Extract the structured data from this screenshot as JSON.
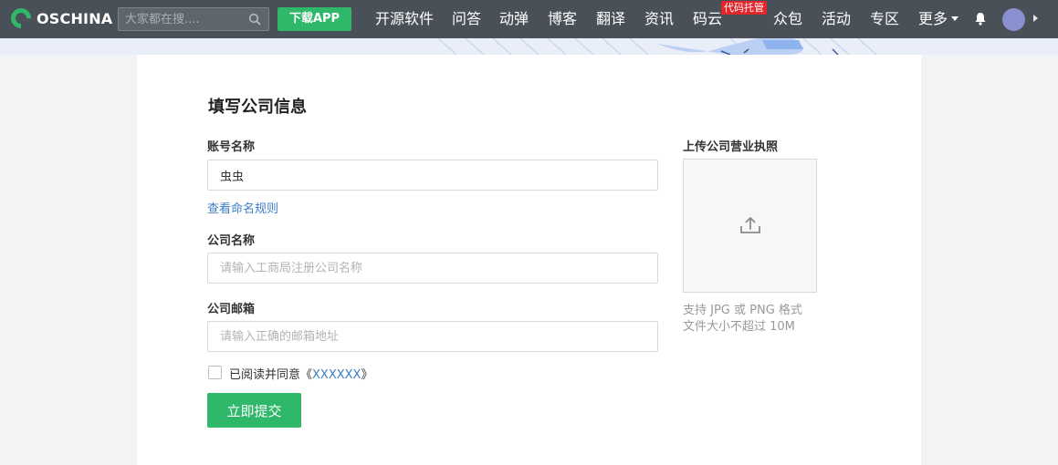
{
  "header": {
    "brand": "OSCHINA",
    "search_placeholder": "大家都在搜....",
    "download_label": "下载APP",
    "nav": [
      "开源软件",
      "问答",
      "动弹",
      "博客",
      "翻译",
      "资讯",
      "码云",
      "众包",
      "活动",
      "专区",
      "更多"
    ],
    "hot_badge": "代码托管",
    "icons": [
      "search-icon",
      "bell-icon",
      "avatar",
      "caret-down-icon"
    ],
    "colors": {
      "bar": "#495058",
      "accent": "#2fb76a",
      "badge": "#e3262b"
    }
  },
  "form": {
    "title": "填写公司信息",
    "account_label": "账号名称",
    "account_value": "虫虫",
    "naming_rules_link": "查看命名规则",
    "company_label": "公司名称",
    "company_placeholder": "请输入工商局注册公司名称",
    "email_label": "公司邮箱",
    "email_placeholder": "请输入正确的邮箱地址",
    "agree_prefix": "已阅读并同意《",
    "agree_link": "XXXXXX",
    "agree_suffix": "》",
    "submit_label": "立即提交"
  },
  "upload": {
    "label": "上传公司营业执照",
    "hint_line1": "支持 JPG 或 PNG 格式",
    "hint_line2": "文件大小不超过 10M"
  }
}
